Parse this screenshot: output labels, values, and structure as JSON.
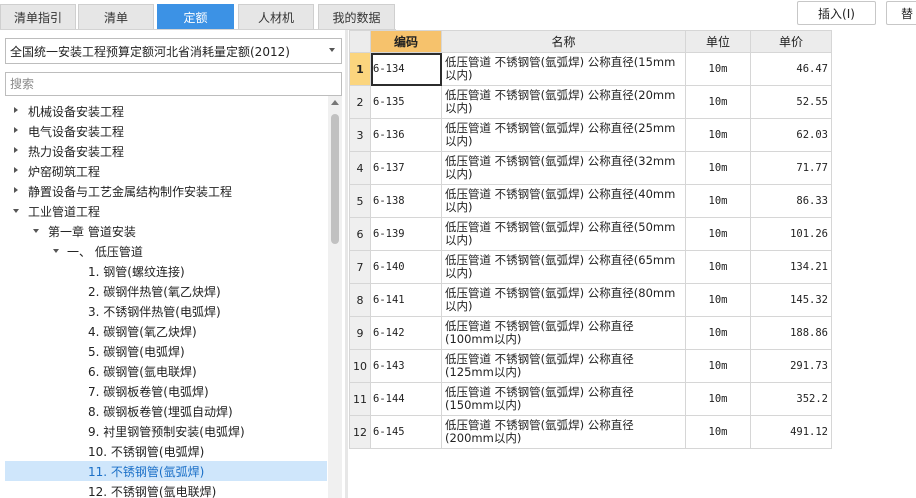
{
  "tabs": [
    {
      "label": "清单指引",
      "active": false
    },
    {
      "label": "清单",
      "active": false
    },
    {
      "label": "定额",
      "active": true
    },
    {
      "label": "人材机",
      "active": false
    },
    {
      "label": "我的数据",
      "active": false
    }
  ],
  "toolbar": {
    "insert_label": "插入(I)",
    "replace_label": "替"
  },
  "quota_select": {
    "value": "全国统一安装工程预算定额河北省消耗量定额(2012)"
  },
  "search": {
    "placeholder": "搜索"
  },
  "tree": [
    {
      "label": "机械设备安装工程",
      "expanded": false,
      "selected": false
    },
    {
      "label": "电气设备安装工程",
      "expanded": false,
      "selected": false
    },
    {
      "label": "热力设备安装工程",
      "expanded": false,
      "selected": false
    },
    {
      "label": "炉窑砌筑工程",
      "expanded": false,
      "selected": false
    },
    {
      "label": "静置设备与工艺金属结构制作安装工程",
      "expanded": false,
      "selected": false
    },
    {
      "label": "工业管道工程",
      "expanded": true,
      "selected": false
    },
    {
      "label": "第一章 管道安装",
      "expanded": true,
      "selected": false
    },
    {
      "label": "一、 低压管道",
      "expanded": true,
      "selected": false
    },
    {
      "label": "1. 钢管(螺纹连接)",
      "selected": false
    },
    {
      "label": "2. 碳钢伴热管(氧乙炔焊)",
      "selected": false
    },
    {
      "label": "3. 不锈钢伴热管(电弧焊)",
      "selected": false
    },
    {
      "label": "4. 碳钢管(氧乙炔焊)",
      "selected": false
    },
    {
      "label": "5. 碳钢管(电弧焊)",
      "selected": false
    },
    {
      "label": "6. 碳钢管(氩电联焊)",
      "selected": false
    },
    {
      "label": "7. 碳钢板卷管(电弧焊)",
      "selected": false
    },
    {
      "label": "8. 碳钢板卷管(埋弧自动焊)",
      "selected": false
    },
    {
      "label": "9. 衬里钢管预制安装(电弧焊)",
      "selected": false
    },
    {
      "label": "10. 不锈钢管(电弧焊)",
      "selected": false
    },
    {
      "label": "11. 不锈钢管(氩弧焊)",
      "selected": true
    },
    {
      "label": "12. 不锈钢管(氩电联焊)",
      "selected": false
    }
  ],
  "grid": {
    "headers": {
      "code": "编码",
      "name": "名称",
      "unit": "单位",
      "price": "单价"
    },
    "rows": [
      {
        "idx": "1",
        "code": "6-134",
        "name_l1": "低压管道 不锈钢管(氩弧焊) 公称直径(15mm",
        "name_l2": "以内)",
        "unit": "10m",
        "price": "46.47"
      },
      {
        "idx": "2",
        "code": "6-135",
        "name_l1": "低压管道 不锈钢管(氩弧焊) 公称直径(20mm",
        "name_l2": "以内)",
        "unit": "10m",
        "price": "52.55"
      },
      {
        "idx": "3",
        "code": "6-136",
        "name_l1": "低压管道 不锈钢管(氩弧焊) 公称直径(25mm",
        "name_l2": "以内)",
        "unit": "10m",
        "price": "62.03"
      },
      {
        "idx": "4",
        "code": "6-137",
        "name_l1": "低压管道 不锈钢管(氩弧焊) 公称直径(32mm",
        "name_l2": "以内)",
        "unit": "10m",
        "price": "71.77"
      },
      {
        "idx": "5",
        "code": "6-138",
        "name_l1": "低压管道 不锈钢管(氩弧焊) 公称直径(40mm",
        "name_l2": "以内)",
        "unit": "10m",
        "price": "86.33"
      },
      {
        "idx": "6",
        "code": "6-139",
        "name_l1": "低压管道 不锈钢管(氩弧焊) 公称直径(50mm",
        "name_l2": "以内)",
        "unit": "10m",
        "price": "101.26"
      },
      {
        "idx": "7",
        "code": "6-140",
        "name_l1": "低压管道 不锈钢管(氩弧焊) 公称直径(65mm",
        "name_l2": "以内)",
        "unit": "10m",
        "price": "134.21"
      },
      {
        "idx": "8",
        "code": "6-141",
        "name_l1": "低压管道 不锈钢管(氩弧焊) 公称直径(80mm",
        "name_l2": "以内)",
        "unit": "10m",
        "price": "145.32"
      },
      {
        "idx": "9",
        "code": "6-142",
        "name_l1": "低压管道 不锈钢管(氩弧焊) 公称直径",
        "name_l2": "(100mm以内)",
        "unit": "10m",
        "price": "188.86"
      },
      {
        "idx": "10",
        "code": "6-143",
        "name_l1": "低压管道 不锈钢管(氩弧焊) 公称直径",
        "name_l2": "(125mm以内)",
        "unit": "10m",
        "price": "291.73"
      },
      {
        "idx": "11",
        "code": "6-144",
        "name_l1": "低压管道 不锈钢管(氩弧焊) 公称直径",
        "name_l2": "(150mm以内)",
        "unit": "10m",
        "price": "352.2"
      },
      {
        "idx": "12",
        "code": "6-145",
        "name_l1": "低压管道 不锈钢管(氩弧焊) 公称直径",
        "name_l2": "(200mm以内)",
        "unit": "10m",
        "price": "491.12"
      }
    ]
  },
  "colors": {
    "active_tab": "#3c92e5",
    "selected_header": "#f6c26c",
    "tree_selected": "#cfe6fb"
  },
  "icons": {
    "expand_closed": "triangle-right-icon",
    "expand_open": "triangle-down-icon",
    "dropdown": "chevron-down-icon"
  }
}
